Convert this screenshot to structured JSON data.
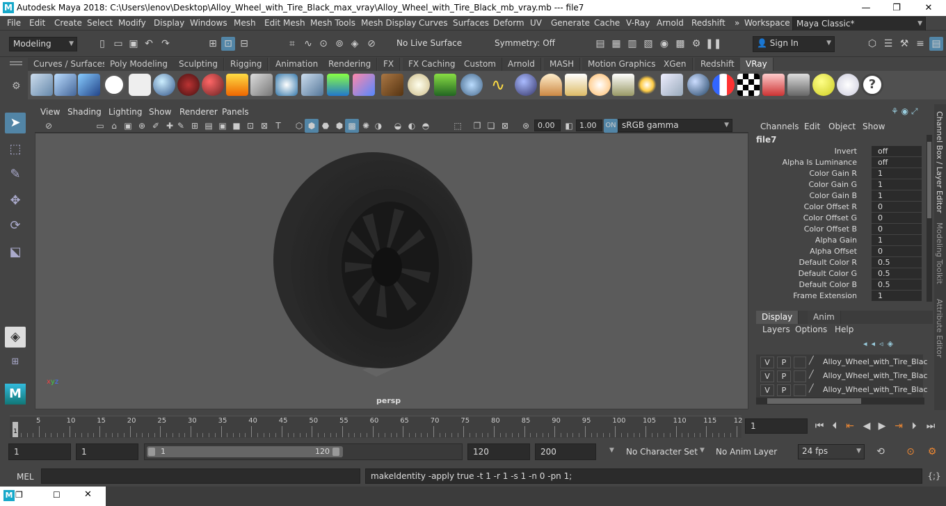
{
  "window": {
    "app_icon": "M",
    "title": "Autodesk Maya 2018: C:\\Users\\lenov\\Desktop\\Alloy_Wheel_with_Tire_Black_max_vray\\Alloy_Wheel_with_Tire_Black_mb_vray.mb   ---   file7",
    "minimize": "—",
    "maximize": "❐",
    "close": "✕"
  },
  "menubar": {
    "items": [
      "File",
      "Edit",
      "Create",
      "Select",
      "Modify",
      "Display",
      "Windows",
      "Mesh",
      "Edit Mesh",
      "Mesh Tools",
      "Mesh Display",
      "Curves",
      "Surfaces",
      "Deform",
      "UV",
      "Generate",
      "Cache",
      "V-Ray",
      "Arnold",
      "Redshift"
    ],
    "overflow": "»",
    "workspace_label": "Workspace :",
    "workspace_value": "Maya Classic*"
  },
  "toolbar": {
    "mode": "Modeling",
    "live_surface": "No Live Surface",
    "symmetry": "Symmetry: Off",
    "sign_in": "Sign In"
  },
  "shelf": {
    "tabs": [
      "Curves / Surfaces",
      "Poly Modeling",
      "Sculpting",
      "Rigging",
      "Animation",
      "Rendering",
      "FX",
      "FX Caching",
      "Custom",
      "Arnold",
      "MASH",
      "Motion Graphics",
      "XGen",
      "Redshift",
      "VRay"
    ],
    "active_tab": "VRay"
  },
  "viewport": {
    "menus": [
      "View",
      "Shading",
      "Lighting",
      "Show",
      "Renderer",
      "Panels"
    ],
    "exposure": "0.00",
    "gamma": "1.00",
    "color_space": "sRGB gamma",
    "camera_label": "persp"
  },
  "channel_box": {
    "menus": [
      "Channels",
      "Edit",
      "Object",
      "Show"
    ],
    "node": "file7",
    "attrs": [
      {
        "name": "Invert",
        "value": "off"
      },
      {
        "name": "Alpha Is Luminance",
        "value": "off"
      },
      {
        "name": "Color Gain R",
        "value": "1"
      },
      {
        "name": "Color Gain G",
        "value": "1"
      },
      {
        "name": "Color Gain B",
        "value": "1"
      },
      {
        "name": "Color Offset R",
        "value": "0"
      },
      {
        "name": "Color Offset G",
        "value": "0"
      },
      {
        "name": "Color Offset B",
        "value": "0"
      },
      {
        "name": "Alpha Gain",
        "value": "1"
      },
      {
        "name": "Alpha Offset",
        "value": "0"
      },
      {
        "name": "Default Color R",
        "value": "0.5"
      },
      {
        "name": "Default Color G",
        "value": "0.5"
      },
      {
        "name": "Default Color B",
        "value": "0.5"
      },
      {
        "name": "Frame Extension",
        "value": "1"
      }
    ]
  },
  "layer_editor": {
    "tabs": [
      "Display",
      "Anim"
    ],
    "menus": [
      "Layers",
      "Options",
      "Help"
    ],
    "v": "V",
    "p": "P",
    "layers": [
      "Alloy_Wheel_with_Tire_Black",
      "Alloy_Wheel_with_Tire_Black",
      "Alloy_Wheel_with_Tire_Black"
    ]
  },
  "side_tabs": [
    "Channel Box / Layer Editor",
    "Modeling Toolkit",
    "Attribute Editor"
  ],
  "timeline": {
    "ticks": [
      "5",
      "10",
      "15",
      "20",
      "25",
      "30",
      "35",
      "40",
      "45",
      "50",
      "55",
      "60",
      "65",
      "70",
      "75",
      "80",
      "85",
      "90",
      "95",
      "100",
      "105",
      "110",
      "115",
      "12"
    ],
    "start_marker": "1",
    "current_frame": "1"
  },
  "range": {
    "start": "1",
    "playback_start": "1",
    "slider_start": "1",
    "slider_end": "120",
    "playback_end": "120",
    "end": "200",
    "character_set": "No Character Set",
    "anim_layer": "No Anim Layer",
    "fps": "24 fps"
  },
  "command_line": {
    "language": "MEL",
    "input": "",
    "result": "makeIdentity -apply true -t 1 -r 1 -s 1 -n 0 -pn 1;"
  },
  "taskbar": {
    "icon": "M"
  },
  "colors": {
    "accent": "#5285a6",
    "background": "#444444",
    "viewport": "#5b5b5b",
    "field": "#2b2b2b"
  }
}
